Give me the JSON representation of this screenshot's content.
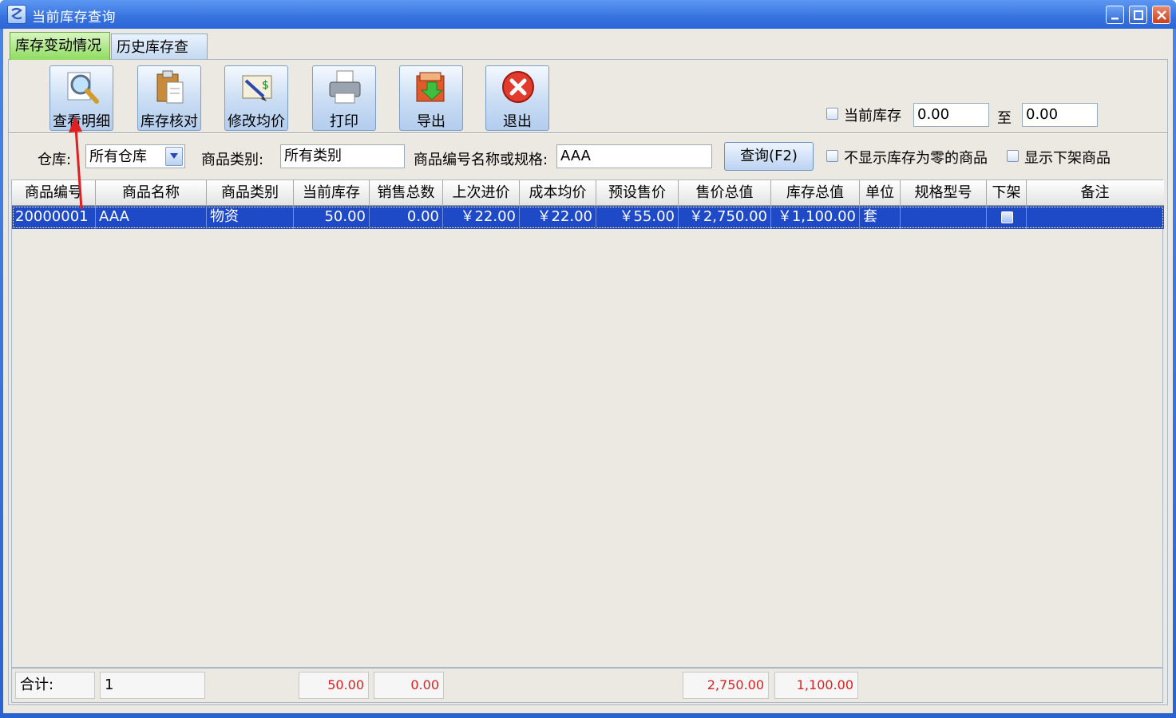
{
  "window": {
    "title": "当前库存查询"
  },
  "tabs": [
    {
      "label": "库存变动情况",
      "active": true
    },
    {
      "label": "历史库存查询",
      "active": false
    }
  ],
  "toolbar": {
    "buttons": [
      {
        "label": "查看明细",
        "icon": "magnifier-icon"
      },
      {
        "label": "库存核对",
        "icon": "clipboard-icon"
      },
      {
        "label": "修改均价",
        "icon": "edit-price-icon"
      },
      {
        "label": "打印",
        "icon": "printer-icon"
      },
      {
        "label": "导出",
        "icon": "export-icon"
      },
      {
        "label": "退出",
        "icon": "exit-icon"
      }
    ],
    "stock_range": {
      "label": "当前库存",
      "from": "0.00",
      "to_label": "至",
      "to": "0.00"
    }
  },
  "filters": {
    "warehouse_label": "仓库:",
    "warehouse_value": "所有仓库",
    "category_label": "商品类别:",
    "category_value": "所有类别",
    "keyword_label": "商品编号名称或规格:",
    "keyword_value": "AAA",
    "query_button": "查询(F2)",
    "hide_zero_label": "不显示库存为零的商品",
    "show_offshelf_label": "显示下架商品"
  },
  "table": {
    "columns": [
      "商品编号",
      "商品名称",
      "商品类别",
      "当前库存",
      "销售总数",
      "上次进价",
      "成本均价",
      "预设售价",
      "售价总值",
      "库存总值",
      "单位",
      "规格型号",
      "下架",
      "备注"
    ],
    "rows": [
      {
        "code": "20000001",
        "name": "AAA",
        "category": "物资",
        "stock": "50.00",
        "sales_total": "0.00",
        "last_price": "￥22.00",
        "avg_cost": "￥22.00",
        "preset_price": "￥55.00",
        "sales_value": "￥2,750.00",
        "stock_value": "￥1,100.00",
        "unit": "套",
        "spec": "",
        "off_shelf": false,
        "note": ""
      }
    ]
  },
  "footer": {
    "total_label": "合计:",
    "count": "1",
    "stock_total": "50.00",
    "sales_total": "0.00",
    "sales_value_total": "2,750.00",
    "stock_value_total": "1,100.00"
  },
  "colors": {
    "selection": "#1e49c7",
    "title_bar": "#3673de",
    "total_red": "#e02020",
    "annotation_arrow": "#e02020"
  }
}
